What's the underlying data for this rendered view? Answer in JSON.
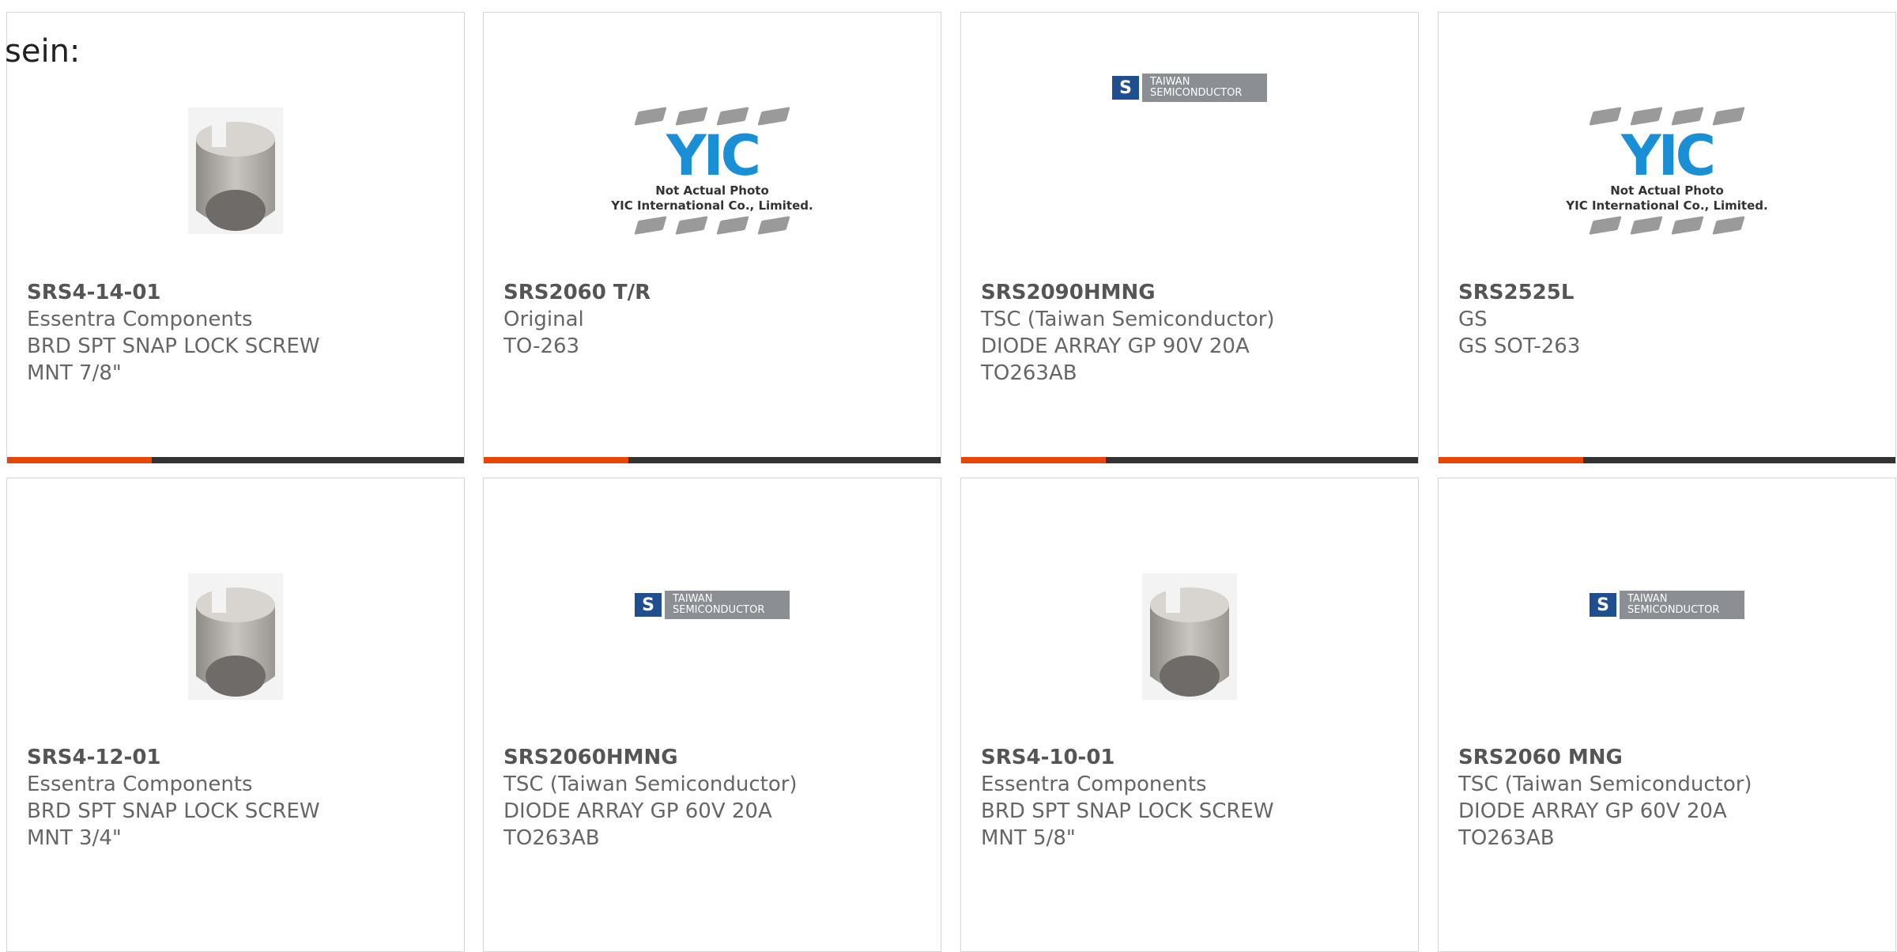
{
  "intro_text": "sein:",
  "colors": {
    "accent": "#e8450a",
    "bar": "#333333",
    "tsc_blue": "#1f4f8f",
    "yic_blue": "#1b8fd6"
  },
  "yic_placeholder": {
    "logo": "YIC",
    "caption_1": "Not Actual Photo",
    "caption_2": "YIC International Co., Limited."
  },
  "tsc_logo": {
    "mark": "S",
    "line_1": "TAIWAN",
    "line_2": "SEMICONDUCTOR"
  },
  "products": [
    {
      "part": "SRS4-14-01",
      "maker": "Essentra Components",
      "desc_1": "BRD SPT SNAP LOCK SCREW",
      "desc_2": "MNT 7/8\"",
      "image": "screw-mount-photo"
    },
    {
      "part": "SRS2060 T/R",
      "maker": "Original",
      "desc_1": "TO-263",
      "desc_2": "",
      "image": "yic-placeholder"
    },
    {
      "part": "SRS2090HMNG",
      "maker": "TSC (Taiwan Semiconductor)",
      "desc_1": "DIODE ARRAY GP 90V 20A",
      "desc_2": "TO263AB",
      "image": "tsc-logo"
    },
    {
      "part": "SRS2525L",
      "maker": "GS",
      "desc_1": "GS SOT-263",
      "desc_2": "",
      "image": "yic-placeholder"
    },
    {
      "part": "SRS4-12-01",
      "maker": "Essentra Components",
      "desc_1": "BRD SPT SNAP LOCK SCREW",
      "desc_2": "MNT 3/4\"",
      "image": "screw-mount-photo"
    },
    {
      "part": "SRS2060HMNG",
      "maker": "TSC (Taiwan Semiconductor)",
      "desc_1": "DIODE ARRAY GP 60V 20A",
      "desc_2": "TO263AB",
      "image": "tsc-logo"
    },
    {
      "part": "SRS4-10-01",
      "maker": "Essentra Components",
      "desc_1": "BRD SPT SNAP LOCK SCREW",
      "desc_2": "MNT 5/8\"",
      "image": "screw-mount-photo"
    },
    {
      "part": "SRS2060 MNG",
      "maker": "TSC (Taiwan Semiconductor)",
      "desc_1": "DIODE ARRAY GP 60V 20A",
      "desc_2": "TO263AB",
      "image": "tsc-logo"
    }
  ]
}
